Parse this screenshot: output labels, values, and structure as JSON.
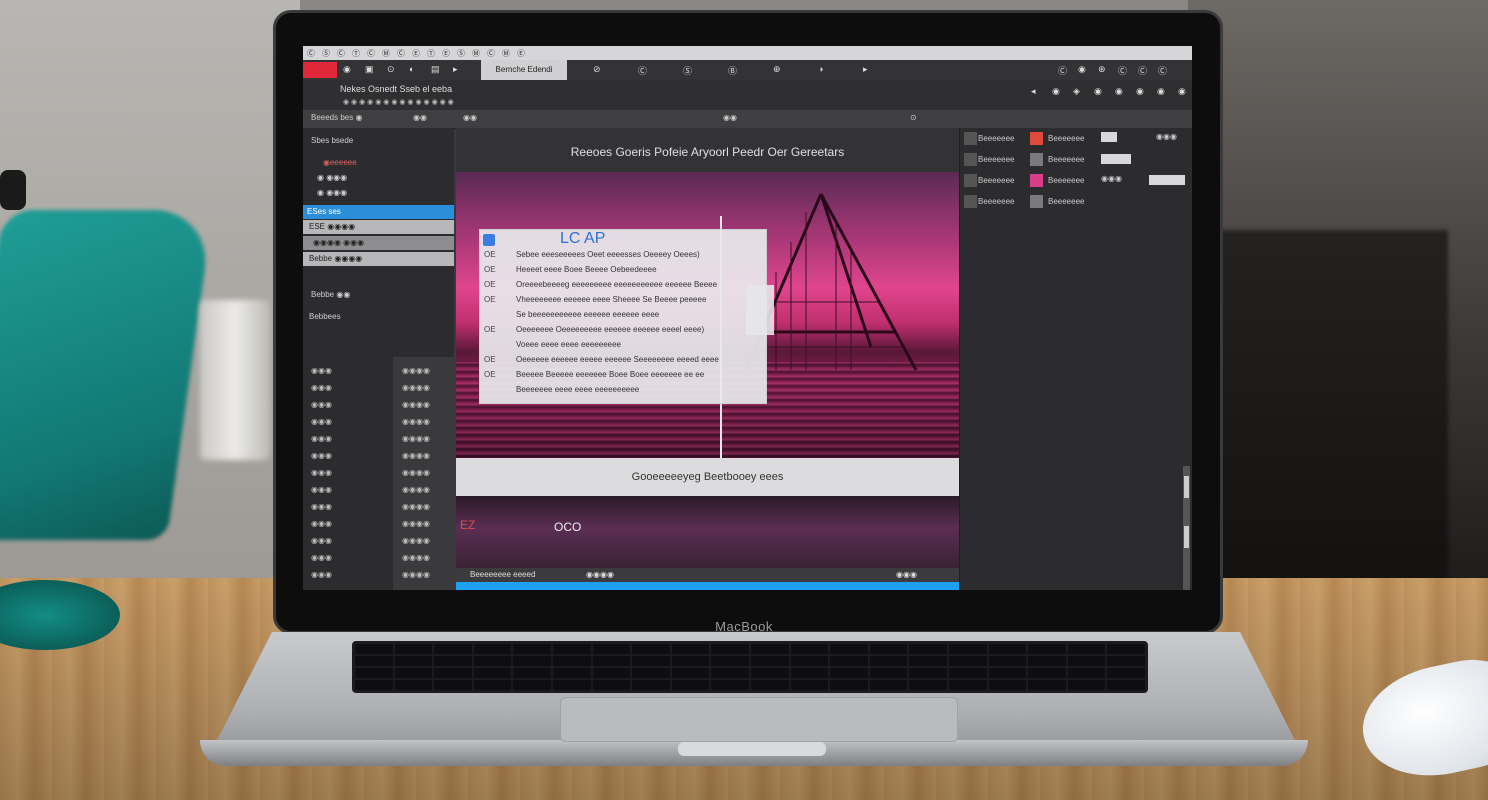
{
  "scene": {
    "laptop_brand": "MacBook"
  },
  "app": {
    "titlebar_items": [
      "Ⓒ",
      "Ⓢ",
      "Ⓒ",
      "Ⓣ",
      "Ⓒ",
      "Ⓜ",
      "Ⓒ",
      "Ⓔ",
      "Ⓣ",
      "Ⓔ",
      "Ⓢ",
      "Ⓜ",
      "Ⓒ",
      "Ⓜ",
      "Ⓔ"
    ],
    "toolbar": {
      "active_tab": "Bernche Edendi",
      "icons_left": [
        "◉",
        "▣",
        "⊙",
        "◐",
        "▤",
        "▸"
      ],
      "items_mid": [
        "⊘",
        "Ⓒ",
        "Ⓢ",
        "Ⓑ",
        "⊕",
        "◑",
        "▸"
      ],
      "items_right": [
        "Ⓒ",
        "◉",
        "⊕",
        "Ⓒ",
        "Ⓒ",
        "Ⓒ"
      ]
    },
    "subbar": {
      "label": "Nekes Osnedt Sseb el eeba",
      "path": "◉ ◉ ◉ ◉ ◉ ◉ ◉ ◉ ◉ ◉ ◉ ◉ ◉ ◉",
      "right_icons": [
        "◂",
        "◉",
        "◈",
        "◉",
        "◉",
        "◉",
        "◉",
        "◉"
      ]
    },
    "panel_bar": {
      "left": "◉◉",
      "mid": "◉◉",
      "right_icon": "⊙"
    },
    "left_panel": {
      "header": "Beeeds bes ◉",
      "rows": [
        {
          "label": "Sbes bsede"
        },
        {
          "label": "◉eeeeee"
        },
        {
          "label": "◉ ◉◉◉"
        },
        {
          "label": "◉ ◉◉◉"
        },
        {
          "label": "ESes ses"
        },
        {
          "label": "ESE ◉◉◉◉"
        },
        {
          "label": "◉◉◉◉ ◉◉◉"
        },
        {
          "label": "Bebbe ◉◉◉◉"
        },
        {
          "label": "Bebbe ◉◉"
        },
        {
          "label": "Bebbees"
        }
      ],
      "numbers": [
        "◉◉◉",
        "◉◉◉",
        "◉◉◉",
        "◉◉◉",
        "◉◉◉",
        "◉◉◉",
        "◉◉◉",
        "◉◉◉",
        "◉◉◉",
        "◉◉◉",
        "◉◉◉",
        "◉◉◉",
        "◉◉◉"
      ],
      "values": [
        "◉◉◉◉",
        "◉◉◉◉",
        "◉◉◉◉",
        "◉◉◉◉",
        "◉◉◉◉",
        "◉◉◉◉",
        "◉◉◉◉",
        "◉◉◉◉",
        "◉◉◉◉",
        "◉◉◉◉",
        "◉◉◉◉",
        "◉◉◉◉",
        "◉◉◉◉"
      ]
    },
    "canvas": {
      "title": "Reeoes Goeris Pofeie Aryoorl Peedr Oer Gereetars",
      "overlay": {
        "heading": "LC AP",
        "lines": [
          {
            "code": "OE",
            "text": "Sebee eeeseeeees Oeet eeeesses Oeeeey Oeees)"
          },
          {
            "code": "OE",
            "text": "Heeeet eeee Boee Beeee Oebeedeeee"
          },
          {
            "code": "OE",
            "text": "Oreeeebeeeeg eeeeeeeee eeeeeeeeeee eeeeee Beeee"
          },
          {
            "code": "OE",
            "text": "Vheeeeeeee eeeeee eeee Sheeee Se Beeee peeeee"
          },
          {
            "code": "",
            "text": "Se beeeeeeeeeee eeeeee eeeeee eeee"
          },
          {
            "code": "OE",
            "text": "Oeeeeeee Oeeeeeeeee eeeeee eeeeee eeeel eeee)"
          },
          {
            "code": "",
            "text": "Voeee eeee eeee eeeeeeeee"
          },
          {
            "code": "OE",
            "text": "Oeeeeee eeeeee eeeee eeeeee Seeeeeeee eeeed eeee"
          },
          {
            "code": "OE",
            "text": "Beeeee Beeeee eeeeeee Boee Boee eeeeeee ee ee"
          },
          {
            "code": "",
            "text": "Beeeeeee eeee eeee eeeeeeeeee"
          }
        ]
      },
      "caption": "Gooeeeeeyeg Beetbooey eees",
      "lower_text": "OCO",
      "lower_red": "EZ",
      "status_left": "Beeeeeeee eeeed",
      "status_mid": "◉◉◉◉",
      "status_right": "◉◉◉"
    },
    "right_panel": {
      "rows": [
        {
          "a": "Beeeeeee",
          "b": "Beeeeeee"
        },
        {
          "a": "Beeeeeee",
          "b": "Beeeeeee"
        },
        {
          "a": "Beeeeeee",
          "b": "Beeeeeee"
        },
        {
          "a": "Beeeeeee",
          "b": "Beeeeeee"
        }
      ],
      "field_labels": [
        "◉◉◉",
        "◉◉◉"
      ],
      "colors": {
        "swatch_red": "#e04a3a",
        "swatch_pink": "#d83d88"
      }
    }
  }
}
